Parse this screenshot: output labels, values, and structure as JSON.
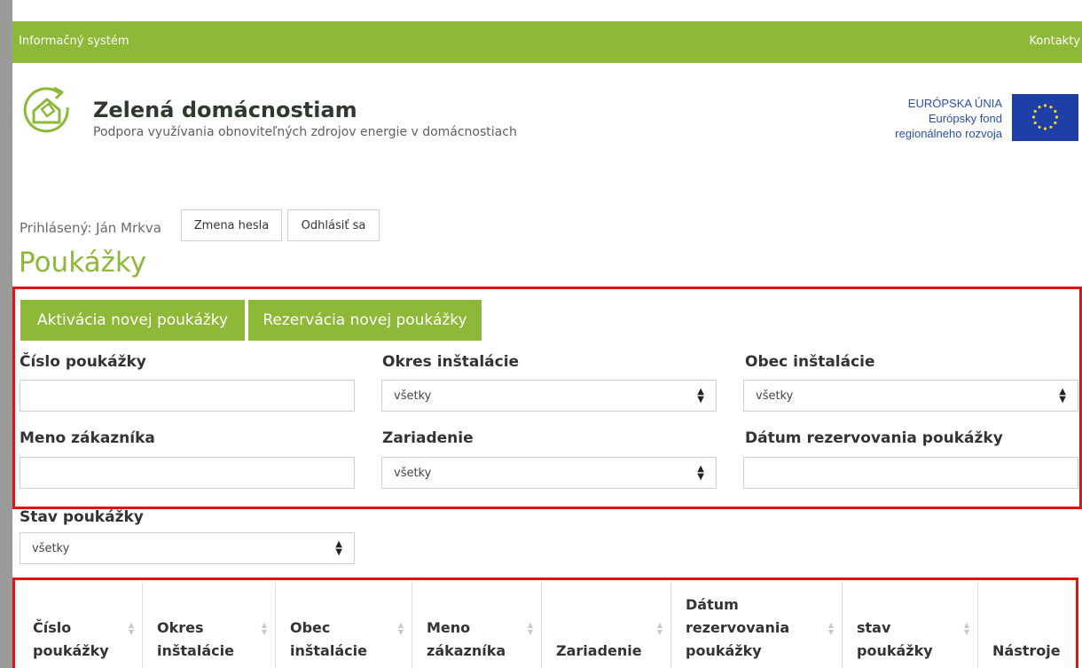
{
  "topbar": {
    "left_label": "Informačný systém",
    "right_label": "Kontakty"
  },
  "brand": {
    "title": "Zelená domácnostiam",
    "subtitle": "Podpora využívania obnoviteľných zdrojov energie v domácnostiach"
  },
  "eu": {
    "line1": "EURÓPSKA ÚNIA",
    "line2": "Európsky fond",
    "line3": "regionálneho rozvoja"
  },
  "user": {
    "label": "Prihlásený: Ján Mrkva",
    "change_password": "Zmena hesla",
    "logout": "Odhlásiť sa"
  },
  "page_title": "Poukážky",
  "actions": {
    "activate": "Aktivácia novej poukážky",
    "reserve": "Rezervácia novej poukážky"
  },
  "filters": {
    "voucher_number": {
      "label": "Číslo poukážky",
      "value": ""
    },
    "district": {
      "label": "Okres inštalácie",
      "value": "všetky"
    },
    "municipality": {
      "label": "Obec inštalácie",
      "value": "všetky"
    },
    "customer": {
      "label": "Meno zákazníka",
      "value": ""
    },
    "device": {
      "label": "Zariadenie",
      "value": "všetky"
    },
    "reservation_date": {
      "label": "Dátum rezervovania poukážky",
      "value": ""
    },
    "status": {
      "label": "Stav poukážky",
      "value": "všetky"
    }
  },
  "table": {
    "columns": [
      {
        "line1": "Číslo",
        "line2": "poukážky"
      },
      {
        "line1": "Okres",
        "line2": "inštalácie"
      },
      {
        "line1": "Obec",
        "line2": "inštalácie"
      },
      {
        "line1": "Meno",
        "line2": "zákazníka"
      },
      {
        "line1": "",
        "line2": "Zariadenie"
      },
      {
        "line0": "Dátum",
        "line1": "rezervovania",
        "line2": "poukážky"
      },
      {
        "line1": "stav",
        "line2": "poukážky"
      },
      {
        "line1": "",
        "line2": "Nástroje"
      }
    ]
  },
  "colors": {
    "brand_green": "#8db838",
    "highlight_red": "#e31313",
    "eu_blue": "#1f3fa8",
    "eu_star": "#ffd617"
  },
  "icons": {
    "logo": "house-leaf-logo-icon",
    "eu_flag": "eu-flag-icon",
    "calendar": "calendar-icon",
    "select_arrow": "sort-arrows-icon"
  }
}
